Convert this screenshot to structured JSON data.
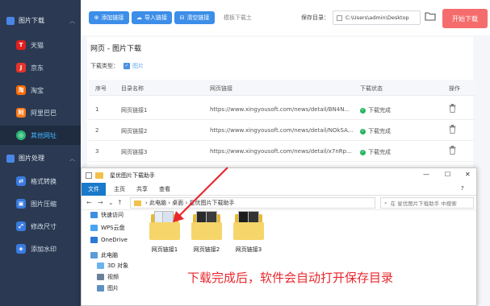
{
  "sidebar": {
    "group_download": "图片下载",
    "group_process": "图片处理",
    "download_items": [
      "天猫",
      "京东",
      "淘宝",
      "阿里巴巴",
      "其他网址"
    ],
    "process_items": [
      "格式转换",
      "图片压缩",
      "修改尺寸",
      "添加水印"
    ],
    "active_item": "其他网址"
  },
  "toolbar": {
    "add_link": "添加链接",
    "import_link": "导入链接",
    "clear_link": "清空链接",
    "template": "模板下载土",
    "save_dir_label": "保存目录：",
    "save_dir_value": "C:\\Users\\admin\\Desktop",
    "start_button": "开始下载"
  },
  "page": {
    "title": "网页 - 图片下载",
    "download_type_label": "下载类型：",
    "download_type_option": "图片"
  },
  "table": {
    "headers": [
      "序号",
      "目录名称",
      "网页链接",
      "下载状态",
      "操作"
    ],
    "rows": [
      {
        "index": "1",
        "name": "网页链接1",
        "url": "https://www.xingyousoft.com/news/detail/BN4N...",
        "status": "下载完成"
      },
      {
        "index": "2",
        "name": "网页链接2",
        "url": "https://www.xingyousoft.com/news/detail/NOkSA...",
        "status": "下载完成"
      },
      {
        "index": "3",
        "name": "网页链接3",
        "url": "https://www.xingyousoft.com/news/detail/x7nRp...",
        "status": "下载完成"
      }
    ]
  },
  "explorer": {
    "title": "星优图片下载助手",
    "ribbon_tabs": [
      "文件",
      "主页",
      "共享",
      "查看"
    ],
    "address": [
      "此电脑",
      "桌面",
      "星优图片下载助手"
    ],
    "search_placeholder": "在 星优图片下载助手 中搜索",
    "nav_items": [
      "快速访问",
      "WPS云盘",
      "OneDrive",
      "此电脑",
      "3D 对象",
      "视频",
      "图片"
    ],
    "files": [
      "网页链接1",
      "网页链接2",
      "网页链接3"
    ]
  },
  "annotation": "下载完成后，软件会自动打开保存目录",
  "colors": {
    "sidebar_bg": "#2b3a52",
    "primary": "#3d8ee8",
    "start_button": "#f56c6c",
    "success": "#26b560",
    "annotation": "#e8272d"
  }
}
